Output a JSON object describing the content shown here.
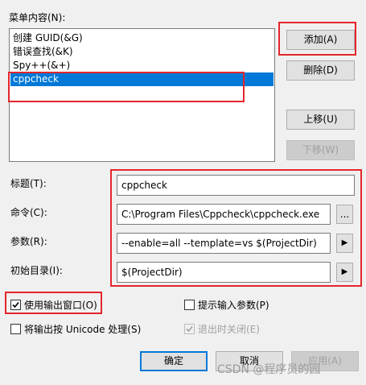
{
  "menu_contents_label": "菜单内容(N):",
  "menu_items": [
    "创建 GUID(&G)",
    "错误查找(&K)",
    "Spy++(&+)",
    "cppcheck"
  ],
  "buttons": {
    "add": "添加(A)",
    "delete": "删除(D)",
    "move_up": "上移(U)",
    "move_down": "下移(W)",
    "ok": "确定",
    "cancel": "取消",
    "apply": "应用(A)"
  },
  "fields": {
    "title_label": "标题(T):",
    "title_value": "cppcheck",
    "command_label": "命令(C):",
    "command_value": "C:\\Program Files\\Cppcheck\\cppcheck.exe",
    "args_label": "参数(R):",
    "args_value": "--enable=all --template=vs $(ProjectDir)",
    "initdir_label": "初始目录(I):",
    "initdir_value": "$(ProjectDir)"
  },
  "browse_glyph": "...",
  "arrow_glyph": "▶",
  "checkboxes": {
    "use_output_window": "使用输出窗口(O)",
    "prompt_args": "提示输入参数(P)",
    "unicode_output": "将输出按 Unicode 处理(S)",
    "close_on_exit": "退出时关闭(E)"
  },
  "watermark": "CSDN @程序员的园"
}
